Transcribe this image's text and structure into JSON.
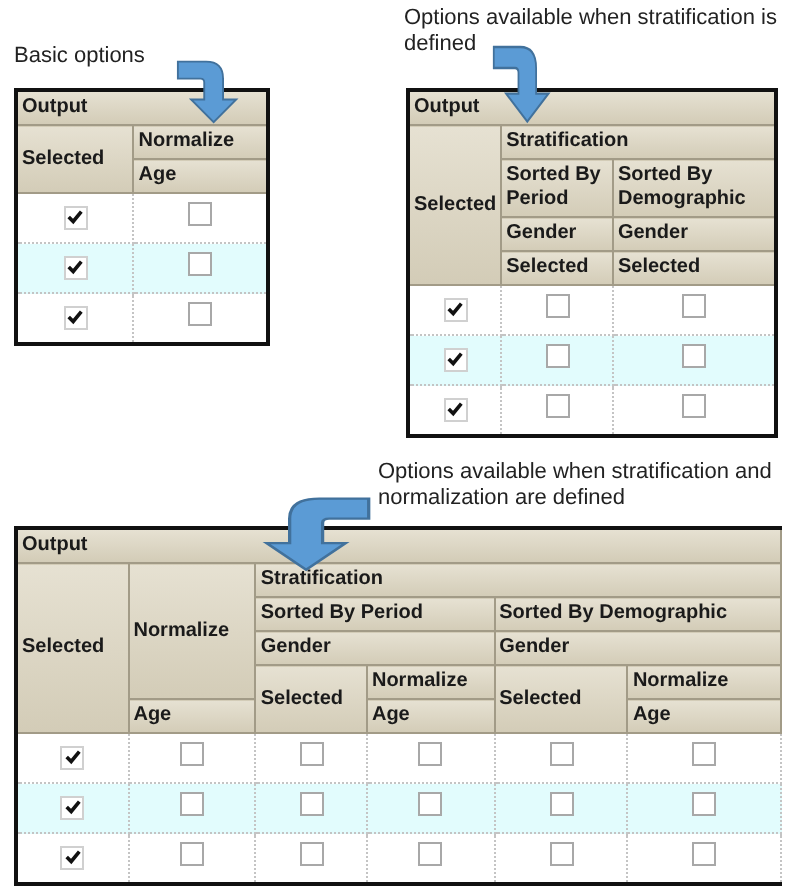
{
  "panels": [
    {
      "caption": "Basic options",
      "header": {
        "label": "Output",
        "children": [
          {
            "label": "Selected"
          },
          {
            "label": "Normalize",
            "children": [
              {
                "label": "Age"
              }
            ]
          }
        ]
      },
      "rows": [
        {
          "cells": [
            {
              "checked": true
            },
            {
              "checked": false
            }
          ]
        },
        {
          "cells": [
            {
              "checked": true
            },
            {
              "checked": false
            }
          ]
        },
        {
          "cells": [
            {
              "checked": true
            },
            {
              "checked": false
            }
          ]
        }
      ]
    },
    {
      "caption": "Options available when stratification is defined",
      "header": {
        "label": "Output",
        "children": [
          {
            "label": "Selected"
          },
          {
            "label": "Stratification",
            "children": [
              {
                "label": "Sorted By Period",
                "children": [
                  {
                    "label": "Gender",
                    "children": [
                      {
                        "label": "Selected"
                      }
                    ]
                  }
                ]
              },
              {
                "label": "Sorted By Demographic",
                "children": [
                  {
                    "label": "Gender",
                    "children": [
                      {
                        "label": "Selected"
                      }
                    ]
                  }
                ]
              }
            ]
          }
        ]
      },
      "rows": [
        {
          "cells": [
            {
              "checked": true
            },
            {
              "checked": false
            },
            {
              "checked": false
            }
          ]
        },
        {
          "cells": [
            {
              "checked": true
            },
            {
              "checked": false
            },
            {
              "checked": false
            }
          ]
        },
        {
          "cells": [
            {
              "checked": true
            },
            {
              "checked": false
            },
            {
              "checked": false
            }
          ]
        }
      ]
    },
    {
      "caption": "Options available when stratification and normalization are defined",
      "header": {
        "label": "Output",
        "children": [
          {
            "label": "Selected"
          },
          {
            "label": "Normalize",
            "children": [
              {
                "label": "Age"
              }
            ]
          },
          {
            "label": "Stratification",
            "children": [
              {
                "label": "Sorted By Period",
                "children": [
                  {
                    "label": "Gender",
                    "children": [
                      {
                        "label": "Selected"
                      },
                      {
                        "label": "Normalize",
                        "children": [
                          {
                            "label": "Age"
                          }
                        ]
                      }
                    ]
                  }
                ]
              },
              {
                "label": "Sorted By Demographic",
                "children": [
                  {
                    "label": "Gender",
                    "children": [
                      {
                        "label": "Selected"
                      },
                      {
                        "label": "Normalize",
                        "children": [
                          {
                            "label": "Age"
                          }
                        ]
                      }
                    ]
                  }
                ]
              }
            ]
          }
        ]
      },
      "rows": [
        {
          "cells": [
            {
              "checked": true
            },
            {
              "checked": false
            },
            {
              "checked": false
            },
            {
              "checked": false
            },
            {
              "checked": false
            },
            {
              "checked": false
            }
          ]
        },
        {
          "cells": [
            {
              "checked": true
            },
            {
              "checked": false
            },
            {
              "checked": false
            },
            {
              "checked": false
            },
            {
              "checked": false
            },
            {
              "checked": false
            }
          ]
        },
        {
          "cells": [
            {
              "checked": true
            },
            {
              "checked": false
            },
            {
              "checked": false
            },
            {
              "checked": false
            },
            {
              "checked": false
            },
            {
              "checked": false
            }
          ]
        }
      ]
    }
  ]
}
